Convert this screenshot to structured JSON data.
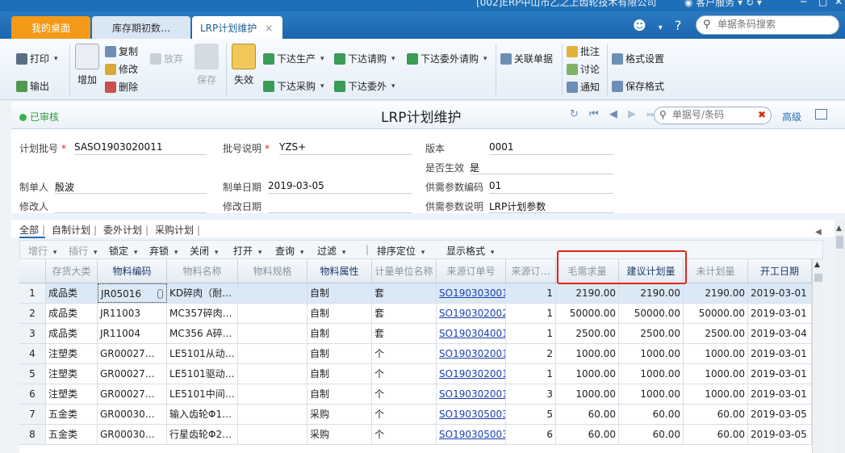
{
  "window": {
    "company": "[002]ERP中山市乙之上齿轮技术有限公司",
    "service": "客户服务",
    "controls": [
      "─",
      "□",
      "✕"
    ]
  },
  "tabs": [
    {
      "label": "我的桌面"
    },
    {
      "label": "库存期初数…"
    },
    {
      "label": "LRP计划维护",
      "close": "×"
    }
  ],
  "top_search": {
    "placeholder": "单据条码搜索"
  },
  "toolbar": {
    "print": "打印",
    "export": "输出",
    "add": "增加",
    "copy": "复制",
    "modify": "修改",
    "delete": "删除",
    "discard": "放弃",
    "save": "保存",
    "invalidate": "失效",
    "issue_production": "下达生产",
    "issue_request": "下达请购",
    "issue_outsource_request": "下达委外请购",
    "issue_purchase": "下达采购",
    "issue_outsource": "下达委外",
    "related_docs": "关联单据",
    "annotate": "批注",
    "discuss": "讨论",
    "notify": "通知",
    "format_settings": "格式设置",
    "save_format": "保存格式"
  },
  "header": {
    "status": "已审核",
    "title": "LRP计划维护",
    "search_placeholder": "单据号/条码",
    "advanced": "高级"
  },
  "form": {
    "batch_no_label": "计划批号",
    "batch_no": "SASO1903020011",
    "batch_desc_label": "批号说明",
    "batch_desc": "YZS+",
    "version_label": "版本",
    "version": "0001",
    "effective_label": "是否生效",
    "effective": "是",
    "creator_label": "制单人",
    "creator": "殷波",
    "create_date_label": "制单日期",
    "create_date": "2019-03-05",
    "param_code_label": "供需参数编码",
    "param_code": "01",
    "modifier_label": "修改人",
    "modifier": "",
    "modify_date_label": "修改日期",
    "modify_date": "",
    "param_desc_label": "供需参数说明",
    "param_desc": "LRP计划参数"
  },
  "lower_tabs": [
    "全部",
    "自制计划",
    "委外计划",
    "采购计划"
  ],
  "grid_toolbar": {
    "add_row": "增行",
    "insert_row": "插行",
    "lock": "锁定",
    "abandon": "弃锁",
    "close": "关闭",
    "open": "打开",
    "query": "查询",
    "filter": "过滤",
    "sort": "排序定位",
    "display_format": "显示格式"
  },
  "columns": [
    "存货大类",
    "物料编码",
    "物料名称",
    "物料规格",
    "物料属性",
    "计量单位名称",
    "来源订单号",
    "来源订…",
    "毛需求量",
    "建议计划量",
    "未计划量",
    "开工日期"
  ],
  "rows": [
    {
      "idx": "1",
      "category": "成品类",
      "code": "JR05016",
      "name": "KD碎肉（耐…",
      "spec": "",
      "attr": "自制",
      "unit": "套",
      "order": "SO190303001",
      "line": "1",
      "gross": "2190.00",
      "suggest": "2190.00",
      "unplanned": "2190.00",
      "start": "2019-03-01"
    },
    {
      "idx": "2",
      "category": "成品类",
      "code": "JR11003",
      "name": "MC357碎肉…",
      "spec": "",
      "attr": "自制",
      "unit": "套",
      "order": "SO190302002",
      "line": "1",
      "gross": "50000.00",
      "suggest": "50000.00",
      "unplanned": "50000.00",
      "start": "2019-03-01"
    },
    {
      "idx": "3",
      "category": "成品类",
      "code": "JR11004",
      "name": "MC356 A碎…",
      "spec": "",
      "attr": "自制",
      "unit": "套",
      "order": "SO190304001",
      "line": "1",
      "gross": "2500.00",
      "suggest": "2500.00",
      "unplanned": "2500.00",
      "start": "2019-03-04"
    },
    {
      "idx": "4",
      "category": "注塑类",
      "code": "GR00027…",
      "name": "LE5101从动…",
      "spec": "",
      "attr": "自制",
      "unit": "个",
      "order": "SO190302001",
      "line": "2",
      "gross": "1000.00",
      "suggest": "1000.00",
      "unplanned": "1000.00",
      "start": "2019-03-01"
    },
    {
      "idx": "5",
      "category": "注塑类",
      "code": "GR00027…",
      "name": "LE5101驱动…",
      "spec": "",
      "attr": "自制",
      "unit": "个",
      "order": "SO190302001",
      "line": "1",
      "gross": "1000.00",
      "suggest": "1000.00",
      "unplanned": "1000.00",
      "start": "2019-03-01"
    },
    {
      "idx": "6",
      "category": "注塑类",
      "code": "GR00027…",
      "name": "LE5101中间…",
      "spec": "",
      "attr": "自制",
      "unit": "个",
      "order": "SO190302001",
      "line": "3",
      "gross": "1000.00",
      "suggest": "1000.00",
      "unplanned": "1000.00",
      "start": "2019-03-01"
    },
    {
      "idx": "7",
      "category": "五金类",
      "code": "GR00030…",
      "name": "输入齿轮Φ1…",
      "spec": "",
      "attr": "采购",
      "unit": "个",
      "order": "SO190305003",
      "line": "5",
      "gross": "60.00",
      "suggest": "60.00",
      "unplanned": "60.00",
      "start": "2019-03-05"
    },
    {
      "idx": "8",
      "category": "五金类",
      "code": "GR00030…",
      "name": "行星齿轮Φ2…",
      "spec": "",
      "attr": "采购",
      "unit": "个",
      "order": "SO190305003",
      "line": "6",
      "gross": "60.00",
      "suggest": "60.00",
      "unplanned": "60.00",
      "start": "2019-03-05"
    }
  ],
  "colors": {
    "accent": "#1f6fb8",
    "home_tab": "#f39a18",
    "highlight": "#e2231a",
    "approved": "#39b24a",
    "link": "#1a3fb0"
  }
}
